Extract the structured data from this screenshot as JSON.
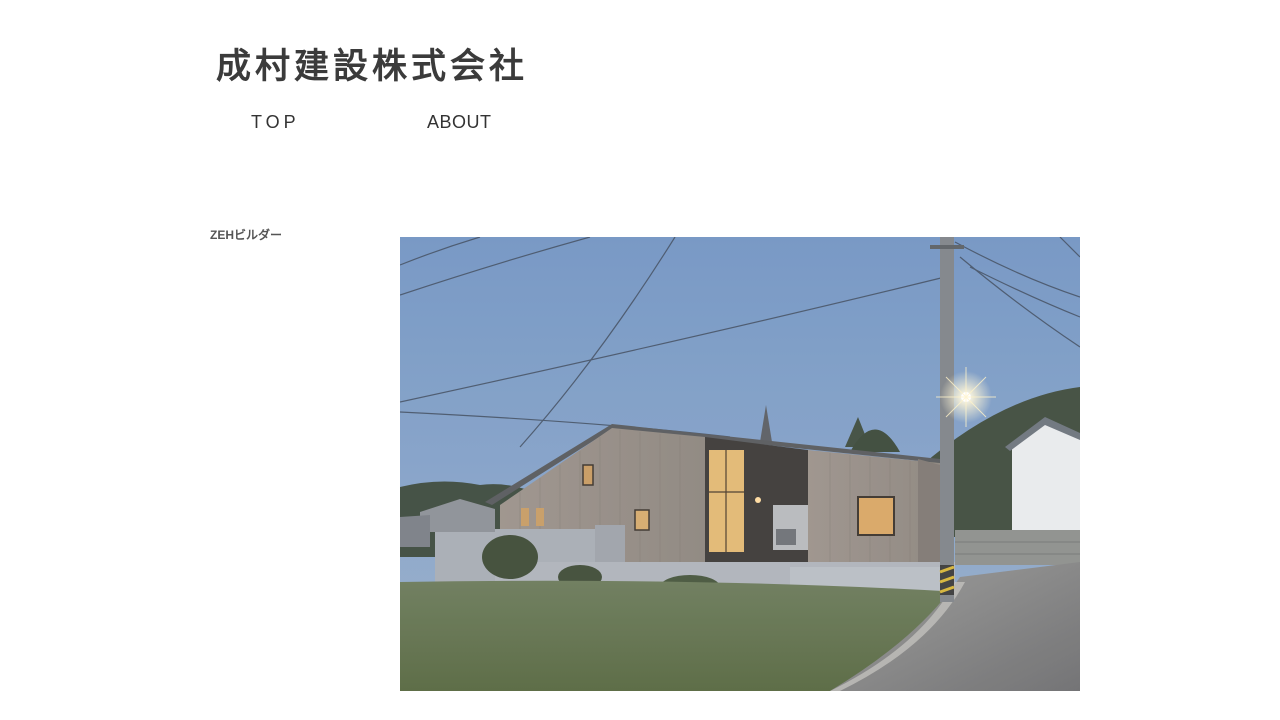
{
  "header": {
    "site_title": "成村建設株式会社"
  },
  "nav": {
    "items": [
      {
        "label": "TOP"
      },
      {
        "label": "ABOUT"
      }
    ]
  },
  "sidebar": {
    "label": "ZEHビルダー"
  }
}
